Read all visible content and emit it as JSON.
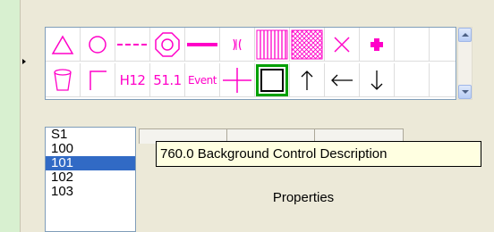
{
  "palette": {
    "text_items": {
      "h12": "H12",
      "val511": "51.1",
      "event": "Event"
    }
  },
  "list": {
    "items": [
      "S1",
      "100",
      "101",
      "102",
      "103"
    ],
    "selected": "101"
  },
  "tooltip": {
    "text": "760.0 Background Control Description"
  },
  "properties_button": {
    "label": "Properties"
  },
  "colors": {
    "accent_magenta": "#ff00c8",
    "selection_blue": "#316ac5",
    "highlight_green": "#00a000"
  }
}
